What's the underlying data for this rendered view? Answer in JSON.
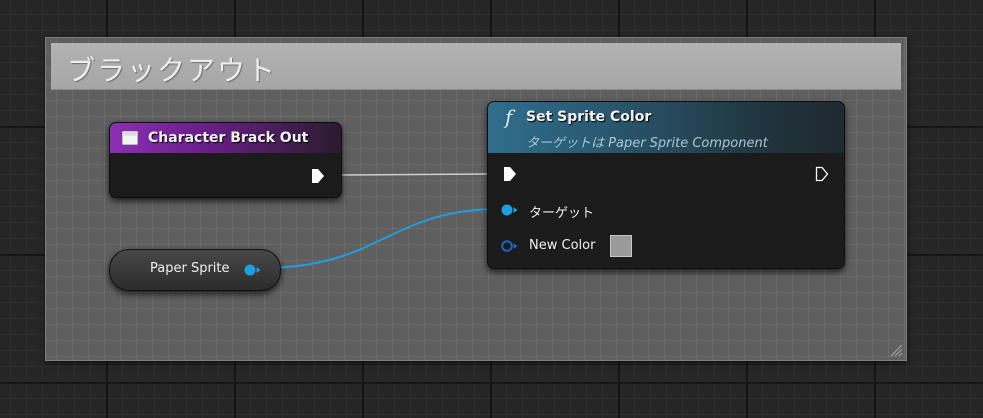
{
  "comment": {
    "title": "ブラックアウト"
  },
  "event_node": {
    "title": "Character Brack Out",
    "icon": "event-icon",
    "header_color": "#8b2fb3"
  },
  "function_node": {
    "icon": "f",
    "title": "Set Sprite Color",
    "subtitle": "ターゲットは Paper Sprite Component",
    "header_color": "#2f6e8c",
    "target_pin_label": "ターゲット",
    "color_pin_label": "New Color",
    "color_value": "#9a9a9a"
  },
  "variable_node": {
    "label": "Paper Sprite"
  },
  "colors": {
    "exec_wire": "#d9d9d9",
    "object_pin": "#1e9fe0",
    "struct_pin": "#0b3b8c"
  }
}
